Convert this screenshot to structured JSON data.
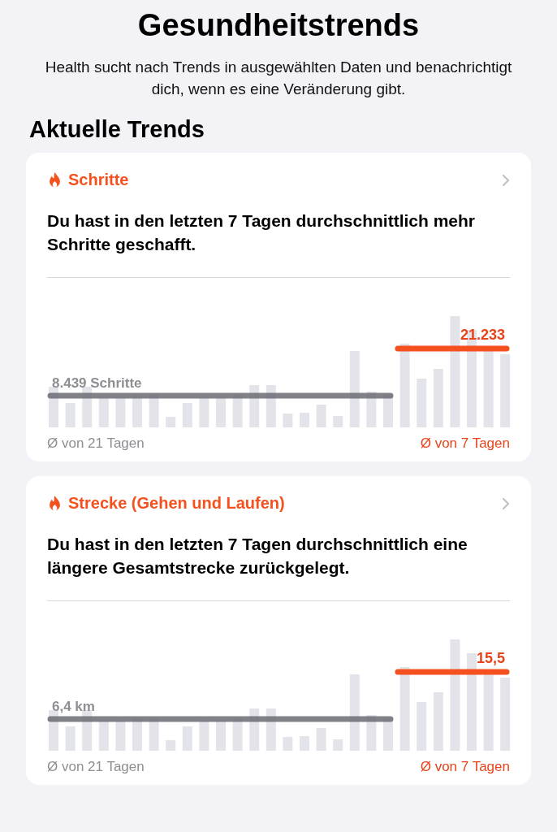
{
  "title": "Gesundheitstrends",
  "intro": "Health sucht nach Trends in ausgewählten Daten und benachrichtigt dich, wenn es eine Veränderung gibt.",
  "section_title": "Aktuelle Trends",
  "trends": [
    {
      "metric": "Schritte",
      "message": "Du hast in den letzten 7 Tagen durchschnittlich mehr Schritte geschafft.",
      "old_average": "8.439 Schritte",
      "new_average": "21.233",
      "old_period": "Ø von 21 Tagen",
      "new_period": "Ø von 7 Tagen"
    },
    {
      "metric": "Strecke (Gehen und Laufen)",
      "message": "Du hast in den letzten 7 Tagen durchschnittlich eine längere Gesamtstrecke zurückgelegt.",
      "old_average": "6,4 km",
      "new_average": "15,5",
      "old_period": "Ø von 21 Tagen",
      "new_period": "Ø von 7 Tagen"
    }
  ]
}
